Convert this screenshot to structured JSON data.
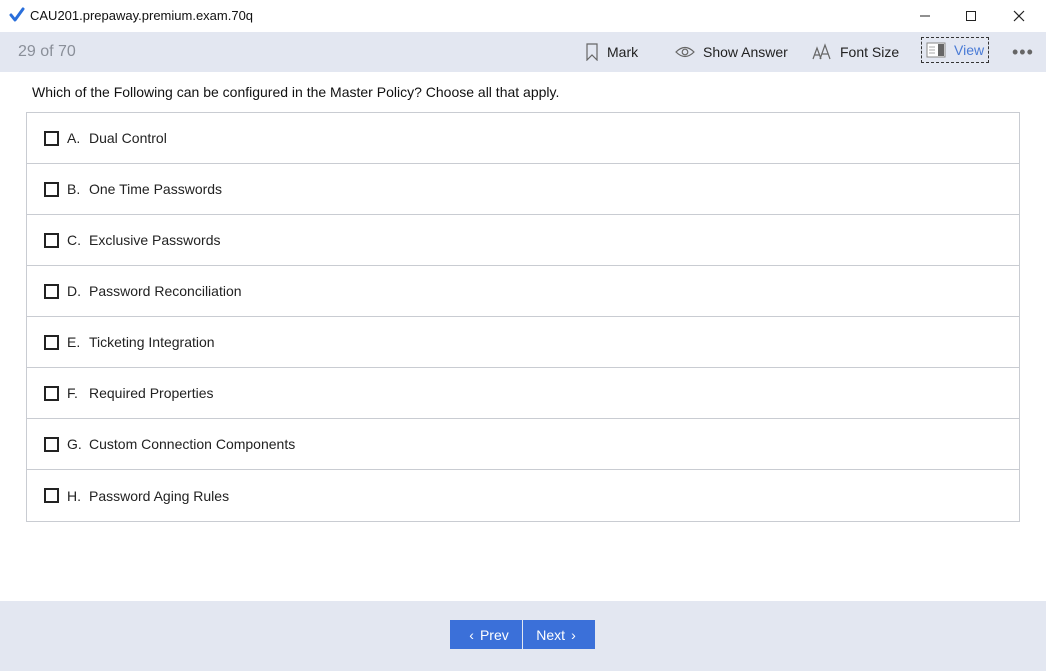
{
  "window": {
    "title": "CAU201.prepaway.premium.exam.70q",
    "controls": [
      "minimize",
      "maximize",
      "close"
    ]
  },
  "toolbar": {
    "counter": "29 of 70",
    "mark_label": "Mark",
    "show_answer_label": "Show Answer",
    "font_size_label": "Font Size",
    "view_label": "View",
    "more_label": "•••"
  },
  "question": {
    "text": "Which of the Following can be configured in the Master Policy? Choose all that apply."
  },
  "options": [
    {
      "letter": "A.",
      "text": "Dual Control",
      "checked": false
    },
    {
      "letter": "B.",
      "text": "One Time Passwords",
      "checked": false
    },
    {
      "letter": "C.",
      "text": "Exclusive Passwords",
      "checked": false
    },
    {
      "letter": "D.",
      "text": "Password Reconciliation",
      "checked": false
    },
    {
      "letter": "E.",
      "text": "Ticketing Integration",
      "checked": false
    },
    {
      "letter": "F.",
      "text": "Required Properties",
      "checked": false
    },
    {
      "letter": "G.",
      "text": "Custom Connection Components",
      "checked": false
    },
    {
      "letter": "H.",
      "text": "Password Aging Rules",
      "checked": false
    }
  ],
  "footer": {
    "prev_label": "Prev",
    "next_label": "Next"
  },
  "colors": {
    "accent": "#3b70d9",
    "toolbar_bg": "#e3e7f1",
    "view_text": "#4a7bd6"
  },
  "icons": [
    "check-icon",
    "bookmark-icon",
    "eye-icon",
    "font-size-icon",
    "view-layout-icon",
    "more-icon",
    "chevron-left-icon",
    "chevron-right-icon"
  ]
}
